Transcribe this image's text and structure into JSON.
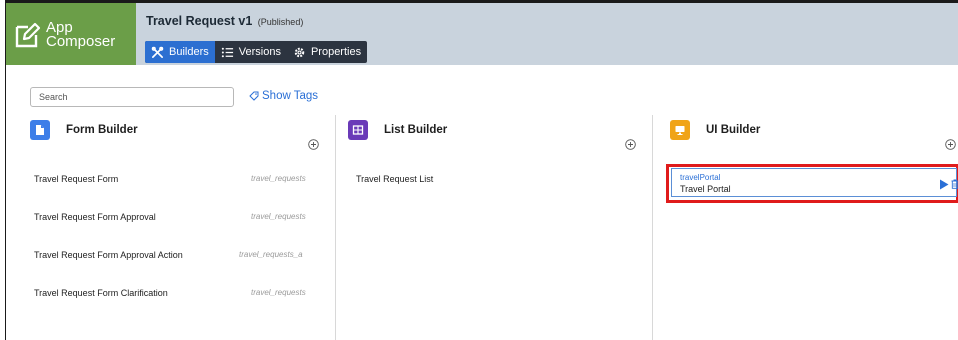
{
  "header": {
    "logo_line1": "App",
    "logo_line2": "Composer",
    "app_title": "Travel Request v1",
    "app_status": "(Published)"
  },
  "nav": {
    "tabs": [
      {
        "label": "Builders",
        "icon": "tools-icon",
        "active": true
      },
      {
        "label": "Versions",
        "icon": "list-icon",
        "active": false
      },
      {
        "label": "Properties",
        "icon": "gear-icon",
        "active": false
      }
    ]
  },
  "search": {
    "placeholder": "Search",
    "value": ""
  },
  "show_tags": {
    "label": "Show Tags",
    "icon": "tag-icon"
  },
  "colors": {
    "logo_bg": "#6b9e48",
    "header_bg": "#c9d3dd",
    "form_builder": "#3d7ee8",
    "list_builder": "#6a3ab8",
    "ui_builder": "#f0a418",
    "highlight": "#e01b1b",
    "active_tab": "#2c6fd1"
  },
  "form_builder": {
    "title": "Form Builder",
    "icon": "document-icon",
    "items": [
      {
        "name": "Travel Request Form",
        "table": "travel_requests"
      },
      {
        "name": "Travel Request Form Approval",
        "table": "travel_requests"
      },
      {
        "name": "Travel Request Form Approval Action",
        "table": "travel_requests_a"
      },
      {
        "name": "Travel Request Form Clarification",
        "table": "travel_requests"
      }
    ]
  },
  "list_builder": {
    "title": "List Builder",
    "icon": "grid-icon",
    "items": [
      {
        "name": "Travel Request List"
      }
    ]
  },
  "ui_builder": {
    "title": "UI Builder",
    "icon": "monitor-icon",
    "items": [
      {
        "key": "travelPortal",
        "name": "Travel Portal"
      }
    ]
  }
}
